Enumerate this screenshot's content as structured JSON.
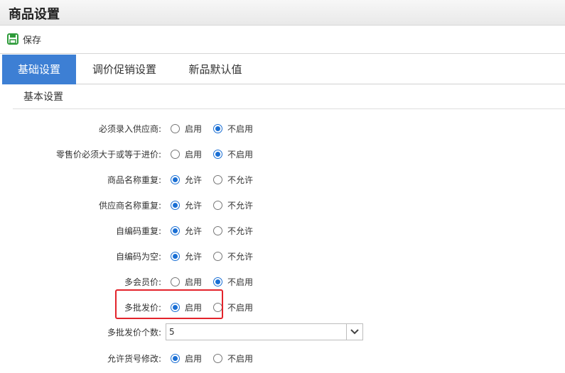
{
  "page": {
    "title": "商品设置"
  },
  "toolbar": {
    "save_label": "保存"
  },
  "tabs": [
    {
      "label": "基础设置",
      "active": true
    },
    {
      "label": "调价促销设置",
      "active": false
    },
    {
      "label": "新品默认值",
      "active": false
    }
  ],
  "section": {
    "title": "基本设置"
  },
  "settings": [
    {
      "label": "必须录入供应商:",
      "options": [
        "启用",
        "不启用"
      ],
      "selected": 1
    },
    {
      "label": "零售价必须大于或等于进价:",
      "options": [
        "启用",
        "不启用"
      ],
      "selected": 1
    },
    {
      "label": "商品名称重复:",
      "options": [
        "允许",
        "不允许"
      ],
      "selected": 0
    },
    {
      "label": "供应商名称重复:",
      "options": [
        "允许",
        "不允许"
      ],
      "selected": 0
    },
    {
      "label": "自编码重复:",
      "options": [
        "允许",
        "不允许"
      ],
      "selected": 0
    },
    {
      "label": "自编码为空:",
      "options": [
        "允许",
        "不允许"
      ],
      "selected": 0
    },
    {
      "label": "多会员价:",
      "options": [
        "启用",
        "不启用"
      ],
      "selected": 1
    },
    {
      "label": "多批发价:",
      "options": [
        "启用",
        "不启用"
      ],
      "selected": 0
    },
    {
      "label": "允许货号修改:",
      "options": [
        "启用",
        "不启用"
      ],
      "selected": 0
    }
  ],
  "wholesale_count": {
    "label": "多批发价个数:",
    "value": "5"
  },
  "colors": {
    "accent": "#3d7fd4",
    "radio": "#1a6fd4",
    "highlight": "#e3232b",
    "save_icon": "#2e9b3a"
  }
}
